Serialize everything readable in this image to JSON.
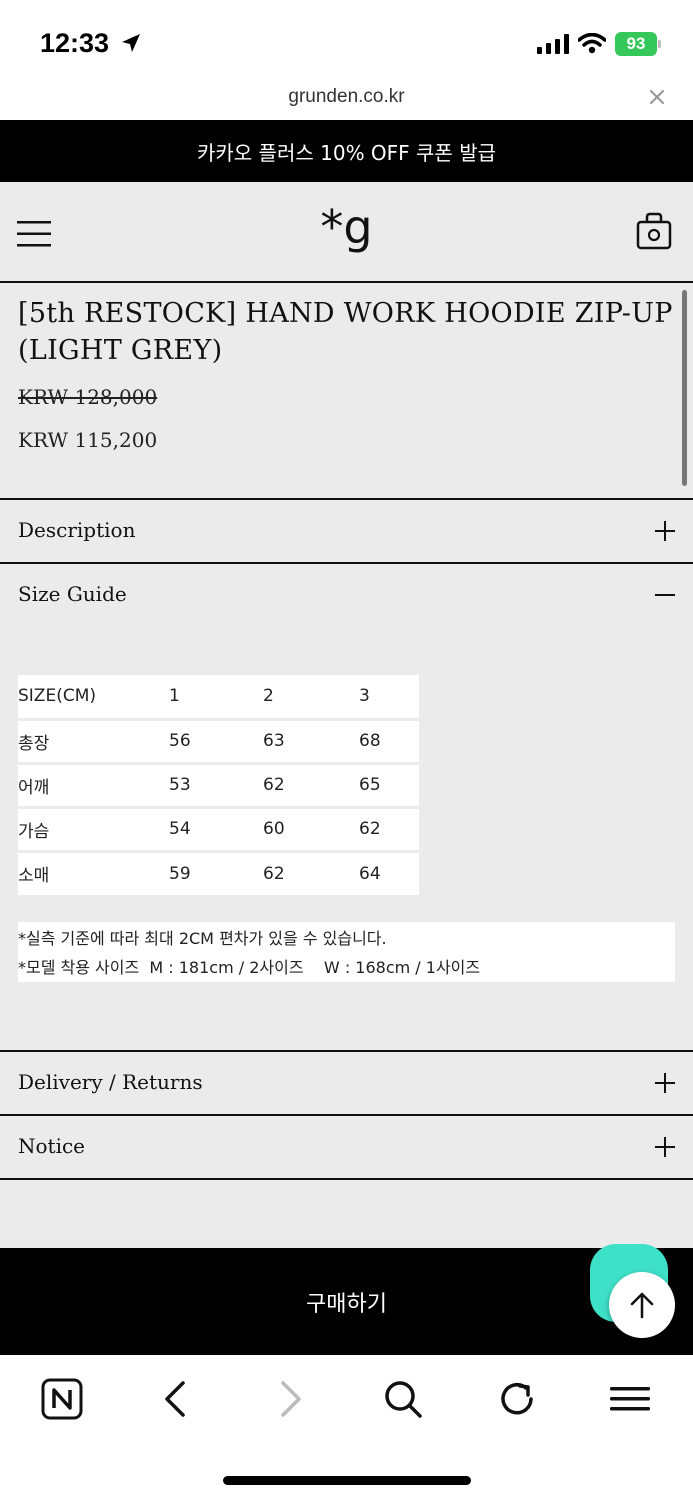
{
  "status_bar": {
    "time": "12:33",
    "battery": "93"
  },
  "browser": {
    "url": "grunden.co.kr"
  },
  "promo": {
    "text": "카카오 플러스 10% OFF 쿠폰 발급"
  },
  "header": {
    "logo": "*g"
  },
  "product": {
    "title": "[5th RESTOCK] HAND WORK HOODIE ZIP-UP (LIGHT GREY)",
    "original_price": "KRW 128,000",
    "sale_price": "KRW 115,200"
  },
  "accordion": {
    "description": "Description",
    "size_guide": "Size Guide",
    "delivery": "Delivery / Returns",
    "notice": "Notice"
  },
  "size_table": {
    "rows": [
      [
        "SIZE(CM)",
        "1",
        "2",
        "3"
      ],
      [
        "총장",
        "56",
        "63",
        "68"
      ],
      [
        "어깨",
        "53",
        "62",
        "65"
      ],
      [
        "가슴",
        "54",
        "60",
        "62"
      ],
      [
        "소매",
        "59",
        "62",
        "64"
      ]
    ]
  },
  "notes": [
    "*실측 기준에 따라 최대 2CM 편차가 있을 수 있습니다.",
    "*모델 착용 사이즈  M : 181cm / 2사이즈    W : 168cm / 1사이즈"
  ],
  "buy_button": {
    "label": "구매하기"
  },
  "colors": {
    "accent_black": "#000000",
    "background": "#ebebeb",
    "chat_fab": "#3fe0c8",
    "battery": "#34c759"
  },
  "icons": [
    "location-arrow-icon",
    "signal-icon",
    "wifi-icon",
    "close-icon",
    "menu-icon",
    "shopping-bag-icon",
    "plus-icon",
    "minus-icon",
    "chat-icon",
    "arrow-up-icon",
    "naver-icon",
    "back-icon",
    "forward-icon",
    "search-icon",
    "reload-icon",
    "hamburger-icon"
  ]
}
